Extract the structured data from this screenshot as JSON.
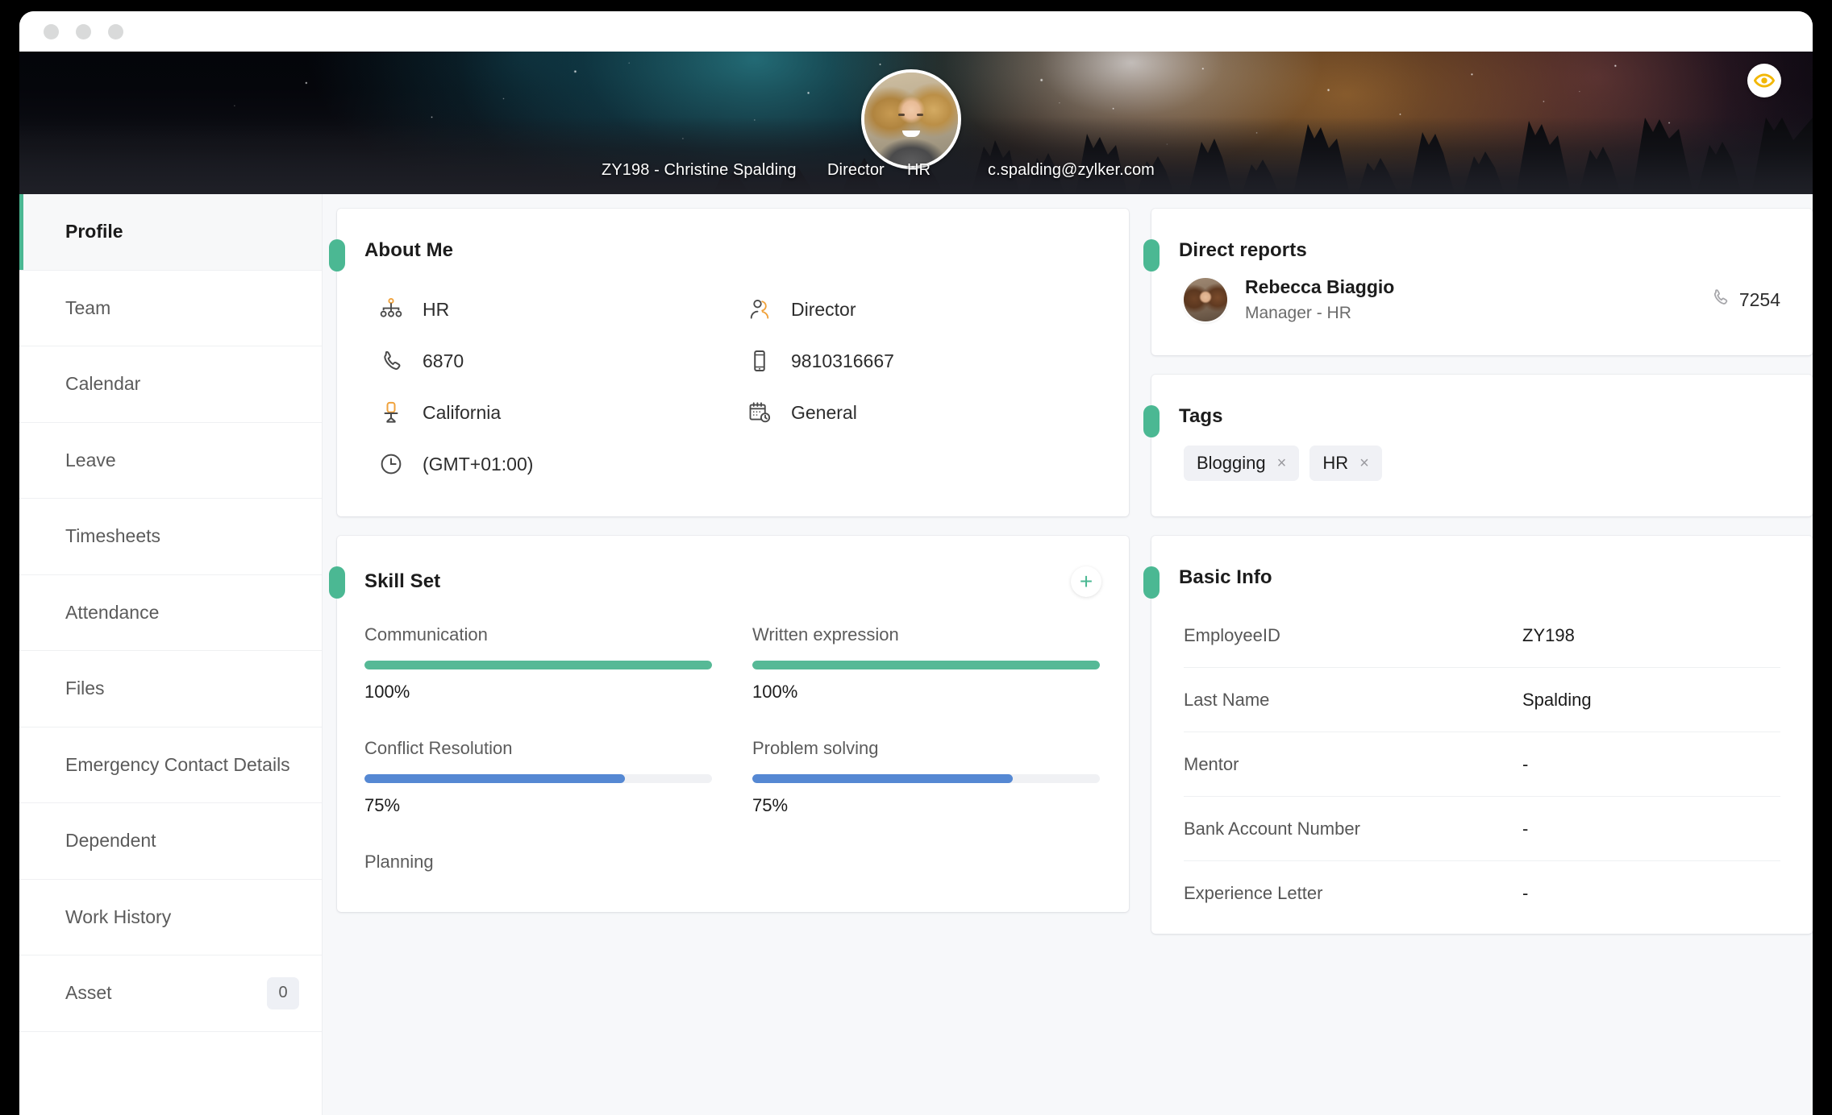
{
  "window": {
    "dots": [
      "close",
      "minimize",
      "maximize"
    ]
  },
  "banner": {
    "employee_label": "ZY198 - Christine Spalding",
    "designation": "Director",
    "department": "HR",
    "email": "c.spalding@zylker.com",
    "eye_icon": "eye-icon",
    "avatar": "employee-avatar"
  },
  "sidebar": {
    "items": [
      {
        "label": "Profile",
        "active": true,
        "badge": null
      },
      {
        "label": "Team",
        "active": false,
        "badge": null
      },
      {
        "label": "Calendar",
        "active": false,
        "badge": null
      },
      {
        "label": "Leave",
        "active": false,
        "badge": null
      },
      {
        "label": "Timesheets",
        "active": false,
        "badge": null
      },
      {
        "label": "Attendance",
        "active": false,
        "badge": null
      },
      {
        "label": "Files",
        "active": false,
        "badge": null
      },
      {
        "label": "Emergency Contact Details",
        "active": false,
        "badge": null
      },
      {
        "label": "Dependent",
        "active": false,
        "badge": null
      },
      {
        "label": "Work History",
        "active": false,
        "badge": null
      },
      {
        "label": "Asset",
        "active": false,
        "badge": "0"
      }
    ]
  },
  "about_me": {
    "title": "About Me",
    "items": [
      {
        "icon": "org-chart-icon",
        "value": "HR"
      },
      {
        "icon": "user-role-icon",
        "value": "Director"
      },
      {
        "icon": "phone-icon",
        "value": "6870"
      },
      {
        "icon": "mobile-icon",
        "value": "9810316667"
      },
      {
        "icon": "office-chair-icon",
        "value": "California"
      },
      {
        "icon": "calendar-clock-icon",
        "value": "General"
      },
      {
        "icon": "clock-icon",
        "value": "(GMT+01:00)"
      }
    ]
  },
  "skill_set": {
    "title": "Skill Set",
    "add_label": "+",
    "colors": {
      "high": "#56b996",
      "mid": "#5588d3",
      "track": "#f0f1f4"
    },
    "skills": [
      {
        "name": "Communication",
        "percent": 100,
        "percent_label": "100%",
        "color": "#56b996"
      },
      {
        "name": "Written expression",
        "percent": 100,
        "percent_label": "100%",
        "color": "#56b996"
      },
      {
        "name": "Conflict Resolution",
        "percent": 75,
        "percent_label": "75%",
        "color": "#5588d3"
      },
      {
        "name": "Problem solving",
        "percent": 75,
        "percent_label": "75%",
        "color": "#5588d3"
      },
      {
        "name": "Planning",
        "percent": 0,
        "percent_label": "",
        "color": "#5588d3"
      }
    ]
  },
  "direct_reports": {
    "title": "Direct reports",
    "people": [
      {
        "name": "Rebecca Biaggio",
        "role": "Manager - HR",
        "phone": "7254",
        "phone_icon": "phone-icon",
        "avatar": "report-avatar"
      }
    ]
  },
  "tags": {
    "title": "Tags",
    "chips": [
      {
        "label": "Blogging",
        "remove": "×"
      },
      {
        "label": "HR",
        "remove": "×"
      }
    ]
  },
  "basic_info": {
    "title": "Basic Info",
    "rows": [
      {
        "label": "EmployeeID",
        "value": "ZY198"
      },
      {
        "label": "Last Name",
        "value": "Spalding"
      },
      {
        "label": "Mentor",
        "value": "-"
      },
      {
        "label": "Bank Account Number",
        "value": "-"
      },
      {
        "label": "Experience Letter",
        "value": "-"
      }
    ]
  },
  "theme": {
    "accent_green": "#4bb893",
    "skill_blue": "#5588d3",
    "eye_gold": "#f2b705",
    "page_bg": "#f7f8fa"
  }
}
